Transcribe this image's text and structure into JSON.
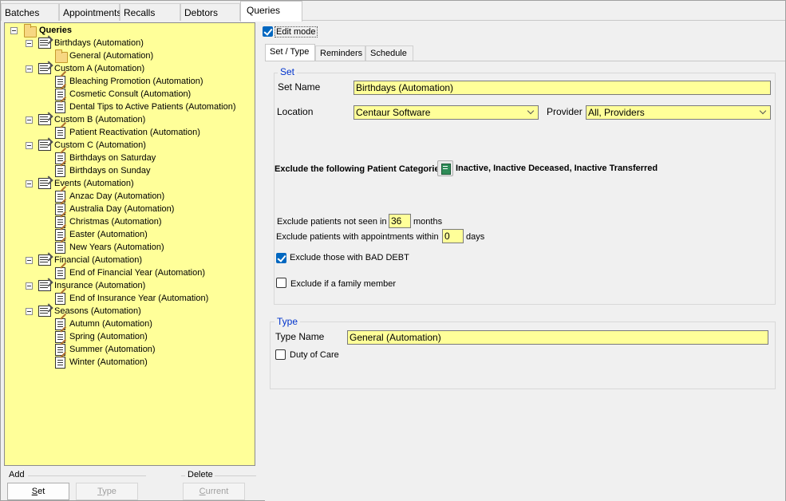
{
  "tabs": {
    "batches": "Batches",
    "appointments": "Appointments",
    "recalls": "Recalls",
    "debtors": "Debtors",
    "queries": "Queries"
  },
  "tree": {
    "root": "Queries",
    "birthdays": "Birthdays (Automation)",
    "birthdays_general": "General (Automation)",
    "custom_a": "Custom A (Automation)",
    "custom_a_1": "Bleaching Promotion (Automation)",
    "custom_a_2": "Cosmetic Consult (Automation)",
    "custom_a_3": "Dental Tips to Active Patients (Automation)",
    "custom_b": "Custom B (Automation)",
    "custom_b_1": "Patient Reactivation (Automation)",
    "custom_c": "Custom C (Automation)",
    "custom_c_1": "Birthdays on Saturday",
    "custom_c_2": "Birthdays on Sunday",
    "events": "Events (Automation)",
    "events_1": "Anzac Day (Automation)",
    "events_2": "Australia Day (Automation)",
    "events_3": "Christmas (Automation)",
    "events_4": "Easter (Automation)",
    "events_5": "New Years (Automation)",
    "financial": "Financial (Automation)",
    "financial_1": "End of Financial Year (Automation)",
    "insurance": "Insurance (Automation)",
    "insurance_1": "End of Insurance Year (Automation)",
    "seasons": "Seasons (Automation)",
    "seasons_1": "Autumn (Automation)",
    "seasons_2": "Spring (Automation)",
    "seasons_3": "Summer (Automation)",
    "seasons_4": "Winter (Automation)"
  },
  "add": {
    "label": "Add",
    "set_prefix": "",
    "set_u": "S",
    "set_rest": "et",
    "type_u": "T",
    "type_rest": "ype"
  },
  "delete": {
    "label": "Delete",
    "current_u": "C",
    "current_rest": "urrent"
  },
  "edit_mode": "Edit mode",
  "inner_tabs": {
    "set_type": "Set / Type",
    "reminders": "Reminders",
    "schedule": "Schedule"
  },
  "set": {
    "legend": "Set",
    "set_name_label": "Set Name",
    "set_name_value": "Birthdays (Automation)",
    "location_label": "Location",
    "location_value": "Centaur Software",
    "provider_label": "Provider",
    "provider_value": "All,   Providers",
    "exclude_categories_label": "Exclude the following Patient Categories:",
    "exclude_categories_value": "Inactive, Inactive Deceased, Inactive Transferred",
    "not_seen_label": "Exclude patients not seen in",
    "not_seen_value": "36",
    "not_seen_unit": "months",
    "appt_within_label": "Exclude patients with appointments within",
    "appt_within_value": "0",
    "appt_within_unit": "days",
    "bad_debt_label": "Exclude those with BAD DEBT",
    "family_label": "Exclude if a family member"
  },
  "type": {
    "legend": "Type",
    "type_name_label": "Type Name",
    "type_name_value": "General (Automation)",
    "duty_label": "Duty of Care"
  }
}
